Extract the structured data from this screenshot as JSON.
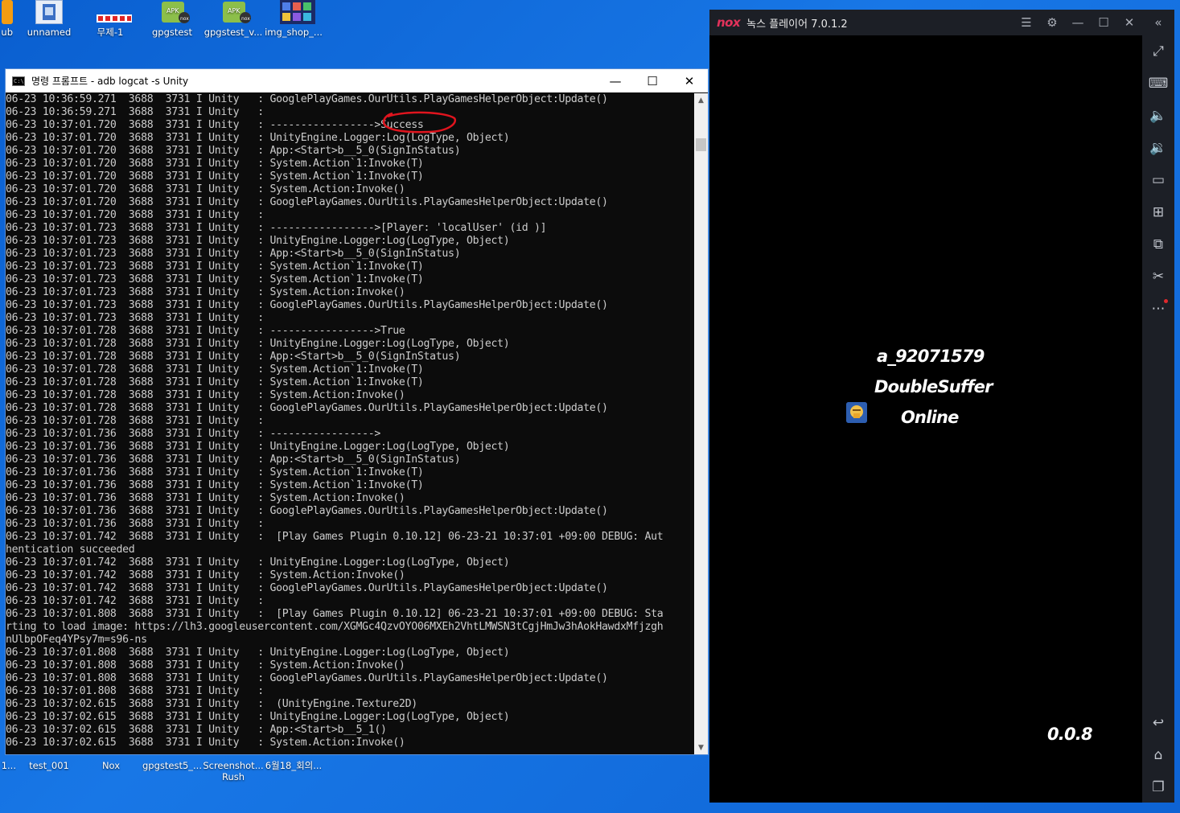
{
  "desktop": {
    "top_icons": [
      {
        "label": "ub",
        "icon": "app-icon"
      },
      {
        "label": "unnamed",
        "icon": "image-file-icon"
      },
      {
        "label": "무제-1",
        "icon": "image-file-icon"
      },
      {
        "label": "gpgstest",
        "icon": "apk-file-icon"
      },
      {
        "label": "gpgstest_v...",
        "icon": "apk-file-icon"
      },
      {
        "label": "img_shop_...",
        "icon": "image-file-icon"
      }
    ],
    "bottom_icons": [
      {
        "label": "1...",
        "icon": "file-icon"
      },
      {
        "label": "test_001",
        "icon": "file-icon"
      },
      {
        "label": "Nox",
        "icon": "nox-shortcut-icon"
      },
      {
        "label": "gpgstest5_...",
        "icon": "file-icon"
      },
      {
        "label": "Screenshot... Rush",
        "icon": "image-file-icon"
      },
      {
        "label": "6월18_회의...",
        "icon": "document-icon"
      }
    ]
  },
  "cmd_window": {
    "title": "명령 프롬프트 - adb  logcat -s Unity",
    "app_icon": "C:\\",
    "minimize": "—",
    "maximize": "☐",
    "close": "✕",
    "scroll_up": "▲",
    "scroll_down": "▼",
    "log_lines": [
      "06-23 10:36:59.271  3688  3731 I Unity   : GooglePlayGames.OurUtils.PlayGamesHelperObject:Update()",
      "06-23 10:36:59.271  3688  3731 I Unity   :",
      "06-23 10:37:01.720  3688  3731 I Unity   : ----------------->Success",
      "06-23 10:37:01.720  3688  3731 I Unity   : UnityEngine.Logger:Log(LogType, Object)",
      "06-23 10:37:01.720  3688  3731 I Unity   : App:<Start>b__5_0(SignInStatus)",
      "06-23 10:37:01.720  3688  3731 I Unity   : System.Action`1:Invoke(T)",
      "06-23 10:37:01.720  3688  3731 I Unity   : System.Action`1:Invoke(T)",
      "06-23 10:37:01.720  3688  3731 I Unity   : System.Action:Invoke()",
      "06-23 10:37:01.720  3688  3731 I Unity   : GooglePlayGames.OurUtils.PlayGamesHelperObject:Update()",
      "06-23 10:37:01.720  3688  3731 I Unity   :",
      "06-23 10:37:01.723  3688  3731 I Unity   : ----------------->[Player: 'localUser' (id )]",
      "06-23 10:37:01.723  3688  3731 I Unity   : UnityEngine.Logger:Log(LogType, Object)",
      "06-23 10:37:01.723  3688  3731 I Unity   : App:<Start>b__5_0(SignInStatus)",
      "06-23 10:37:01.723  3688  3731 I Unity   : System.Action`1:Invoke(T)",
      "06-23 10:37:01.723  3688  3731 I Unity   : System.Action`1:Invoke(T)",
      "06-23 10:37:01.723  3688  3731 I Unity   : System.Action:Invoke()",
      "06-23 10:37:01.723  3688  3731 I Unity   : GooglePlayGames.OurUtils.PlayGamesHelperObject:Update()",
      "06-23 10:37:01.723  3688  3731 I Unity   :",
      "06-23 10:37:01.728  3688  3731 I Unity   : ----------------->True",
      "06-23 10:37:01.728  3688  3731 I Unity   : UnityEngine.Logger:Log(LogType, Object)",
      "06-23 10:37:01.728  3688  3731 I Unity   : App:<Start>b__5_0(SignInStatus)",
      "06-23 10:37:01.728  3688  3731 I Unity   : System.Action`1:Invoke(T)",
      "06-23 10:37:01.728  3688  3731 I Unity   : System.Action`1:Invoke(T)",
      "06-23 10:37:01.728  3688  3731 I Unity   : System.Action:Invoke()",
      "06-23 10:37:01.728  3688  3731 I Unity   : GooglePlayGames.OurUtils.PlayGamesHelperObject:Update()",
      "06-23 10:37:01.728  3688  3731 I Unity   :",
      "06-23 10:37:01.736  3688  3731 I Unity   : ----------------->",
      "06-23 10:37:01.736  3688  3731 I Unity   : UnityEngine.Logger:Log(LogType, Object)",
      "06-23 10:37:01.736  3688  3731 I Unity   : App:<Start>b__5_0(SignInStatus)",
      "06-23 10:37:01.736  3688  3731 I Unity   : System.Action`1:Invoke(T)",
      "06-23 10:37:01.736  3688  3731 I Unity   : System.Action`1:Invoke(T)",
      "06-23 10:37:01.736  3688  3731 I Unity   : System.Action:Invoke()",
      "06-23 10:37:01.736  3688  3731 I Unity   : GooglePlayGames.OurUtils.PlayGamesHelperObject:Update()",
      "06-23 10:37:01.736  3688  3731 I Unity   :",
      "06-23 10:37:01.742  3688  3731 I Unity   :  [Play Games Plugin 0.10.12] 06-23-21 10:37:01 +09:00 DEBUG: Aut",
      "hentication succeeded",
      "06-23 10:37:01.742  3688  3731 I Unity   : UnityEngine.Logger:Log(LogType, Object)",
      "06-23 10:37:01.742  3688  3731 I Unity   : System.Action:Invoke()",
      "06-23 10:37:01.742  3688  3731 I Unity   : GooglePlayGames.OurUtils.PlayGamesHelperObject:Update()",
      "06-23 10:37:01.742  3688  3731 I Unity   :",
      "06-23 10:37:01.808  3688  3731 I Unity   :  [Play Games Plugin 0.10.12] 06-23-21 10:37:01 +09:00 DEBUG: Sta",
      "rting to load image: https://lh3.googleusercontent.com/XGMGc4QzvOYO06MXEh2VhtLMWSN3tCgjHmJw3hAokHawdxMfjzgh",
      "nUlbpOFeq4YPsy7m=s96-ns",
      "06-23 10:37:01.808  3688  3731 I Unity   : UnityEngine.Logger:Log(LogType, Object)",
      "06-23 10:37:01.808  3688  3731 I Unity   : System.Action:Invoke()",
      "06-23 10:37:01.808  3688  3731 I Unity   : GooglePlayGames.OurUtils.PlayGamesHelperObject:Update()",
      "06-23 10:37:01.808  3688  3731 I Unity   :",
      "06-23 10:37:02.615  3688  3731 I Unity   :  (UnityEngine.Texture2D)",
      "06-23 10:37:02.615  3688  3731 I Unity   : UnityEngine.Logger:Log(LogType, Object)",
      "06-23 10:37:02.615  3688  3731 I Unity   : App:<Start>b__5_1()",
      "06-23 10:37:02.615  3688  3731 I Unity   : System.Action:Invoke()"
    ]
  },
  "nox_window": {
    "logo": "nox",
    "title": "녹스 플레이어 7.0.1.2",
    "title_buttons": [
      {
        "name": "menu-icon",
        "glyph": "☰"
      },
      {
        "name": "settings-icon",
        "glyph": "⚙"
      },
      {
        "name": "minimize-icon",
        "glyph": "—"
      },
      {
        "name": "maximize-icon",
        "glyph": "☐"
      },
      {
        "name": "close-icon",
        "glyph": "✕"
      },
      {
        "name": "collapse-sidebar-icon",
        "glyph": "«"
      }
    ],
    "sidebar_buttons": [
      {
        "name": "fullscreen-icon",
        "glyph": "⤢"
      },
      {
        "name": "keyboard-icon",
        "glyph": "⌨"
      },
      {
        "name": "volume-up-icon",
        "glyph": "🔈"
      },
      {
        "name": "volume-down-icon",
        "glyph": "🔉"
      },
      {
        "name": "screen-icon",
        "glyph": "▭"
      },
      {
        "name": "apk-install-icon",
        "glyph": "⊞"
      },
      {
        "name": "multi-instance-icon",
        "glyph": "⧉"
      },
      {
        "name": "scissors-icon",
        "glyph": "✂"
      },
      {
        "name": "more-icon",
        "glyph": "⋯"
      }
    ],
    "bottom_buttons": [
      {
        "name": "back-icon",
        "glyph": "↩"
      },
      {
        "name": "home-icon",
        "glyph": "⌂"
      },
      {
        "name": "recent-apps-icon",
        "glyph": "❐"
      }
    ],
    "game": {
      "user_id": "a_92071579",
      "player_name": "DoubleSuffer",
      "status": "Online",
      "version": "0.0.8"
    }
  }
}
